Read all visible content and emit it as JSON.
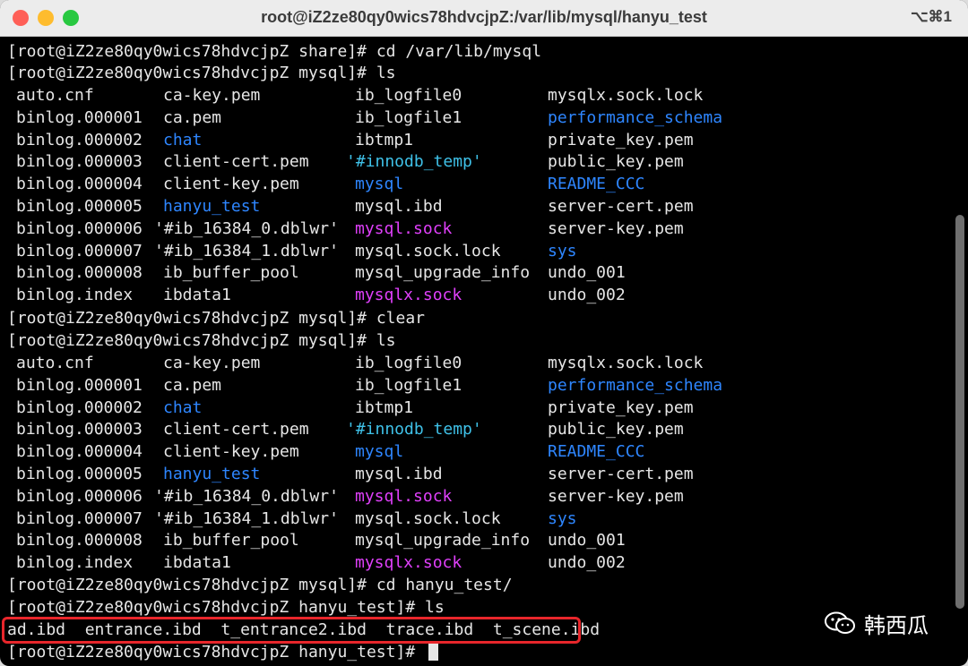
{
  "window": {
    "title": "root@iZ2ze80qy0wics78hdvcjpZ:/var/lib/mysql/hanyu_test",
    "shortcut": "⌥⌘1"
  },
  "colors": {
    "default_text": "#e6e6e6",
    "directory": "#2e86ff",
    "socket": "#e040fb",
    "quoted": "#3fc1e8",
    "highlight_box": "#e8262b"
  },
  "terminal": {
    "prompt_share": "[root@iZ2ze80qy0wics78hdvcjpZ share]# ",
    "cmd_cd_mysql": "cd /var/lib/mysql",
    "prompt_mysql": "[root@iZ2ze80qy0wics78hdvcjpZ mysql]# ",
    "cmd_ls": "ls",
    "cmd_clear": "clear",
    "cmd_cd_hanyu": "cd hanyu_test/",
    "prompt_hanyu": "[root@iZ2ze80qy0wics78hdvcjpZ hanyu_test]# ",
    "listing": [
      [
        {
          "t": "auto.cnf",
          "c": "white"
        },
        {
          "t": "ca-key.pem",
          "c": "white"
        },
        {
          "t": "ib_logfile0",
          "c": "white"
        },
        {
          "t": "mysqlx.sock.lock",
          "c": "white"
        }
      ],
      [
        {
          "t": "binlog.000001",
          "c": "white"
        },
        {
          "t": "ca.pem",
          "c": "white"
        },
        {
          "t": "ib_logfile1",
          "c": "white"
        },
        {
          "t": "performance_schema",
          "c": "blue"
        }
      ],
      [
        {
          "t": "binlog.000002",
          "c": "white"
        },
        {
          "t": "chat",
          "c": "blue"
        },
        {
          "t": "ibtmp1",
          "c": "white"
        },
        {
          "t": "private_key.pem",
          "c": "white"
        }
      ],
      [
        {
          "t": "binlog.000003",
          "c": "white"
        },
        {
          "t": "client-cert.pem",
          "c": "white"
        },
        {
          "t": "'#innodb_temp'",
          "c": "cyan"
        },
        {
          "t": "public_key.pem",
          "c": "white"
        }
      ],
      [
        {
          "t": "binlog.000004",
          "c": "white"
        },
        {
          "t": "client-key.pem",
          "c": "white"
        },
        {
          "t": "mysql",
          "c": "blue"
        },
        {
          "t": "README_CCC",
          "c": "blue"
        }
      ],
      [
        {
          "t": "binlog.000005",
          "c": "white"
        },
        {
          "t": "hanyu_test",
          "c": "blue"
        },
        {
          "t": "mysql.ibd",
          "c": "white"
        },
        {
          "t": "server-cert.pem",
          "c": "white"
        }
      ],
      [
        {
          "t": "binlog.000006",
          "c": "white"
        },
        {
          "t": "'#ib_16384_0.dblwr'",
          "c": "white"
        },
        {
          "t": "mysql.sock",
          "c": "magenta"
        },
        {
          "t": "server-key.pem",
          "c": "white"
        }
      ],
      [
        {
          "t": "binlog.000007",
          "c": "white"
        },
        {
          "t": "'#ib_16384_1.dblwr'",
          "c": "white"
        },
        {
          "t": "mysql.sock.lock",
          "c": "white"
        },
        {
          "t": "sys",
          "c": "blue"
        }
      ],
      [
        {
          "t": "binlog.000008",
          "c": "white"
        },
        {
          "t": "ib_buffer_pool",
          "c": "white"
        },
        {
          "t": "mysql_upgrade_info",
          "c": "white"
        },
        {
          "t": "undo_001",
          "c": "white"
        }
      ],
      [
        {
          "t": "binlog.index",
          "c": "white"
        },
        {
          "t": "ibdata1",
          "c": "white"
        },
        {
          "t": "mysqlx.sock",
          "c": "magenta"
        },
        {
          "t": "undo_002",
          "c": "white"
        }
      ]
    ],
    "hanyu_files": [
      "ad.ibd",
      "entrance.ibd",
      "t_entrance2.ibd",
      "trace.ibd",
      "t_scene.ibd"
    ]
  },
  "watermark": {
    "label": "韩西瓜",
    "icon": "wechat-icon"
  }
}
